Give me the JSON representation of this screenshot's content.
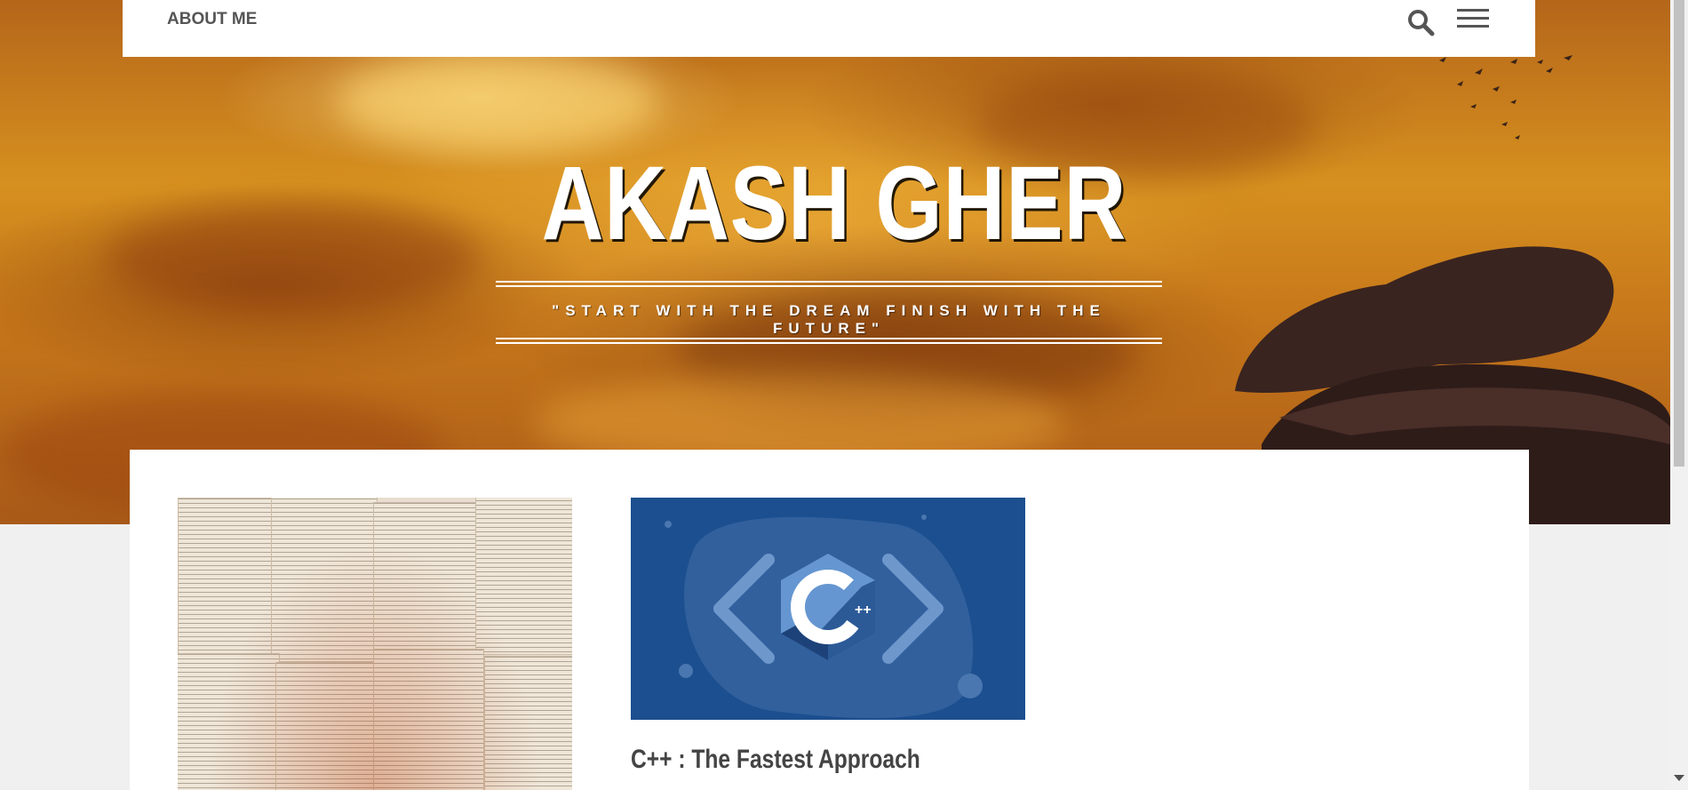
{
  "nav": {
    "about_label": "ABOUT ME",
    "search_icon": "search-icon",
    "menu_icon": "hamburger-menu-icon"
  },
  "hero": {
    "title": "AKASH GHER",
    "tagline": "\"START WITH THE DREAM FINISH WITH THE FUTURE\""
  },
  "posts": [
    {
      "image": "open-books-photo",
      "title": ""
    },
    {
      "image": "cpp-logo-image",
      "title": "C++ : The Fastest Approach",
      "logo_text": "C",
      "logo_plus": "++"
    }
  ],
  "colors": {
    "hero_orange": "#d6901f",
    "cpp_blue": "#1c4f8f",
    "title_text": "#444444",
    "nav_text": "#555555"
  }
}
